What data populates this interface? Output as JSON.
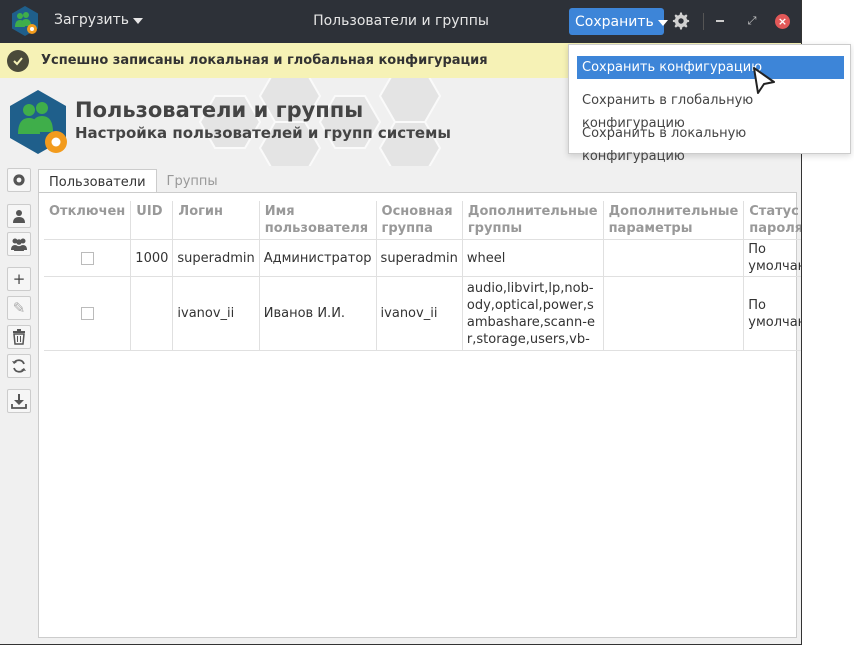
{
  "titlebar": {
    "load_label": "Загрузить",
    "window_title": "Пользователи и группы",
    "save_label": "Сохранить"
  },
  "notification": {
    "text": "Успешно записаны локальная и глобальная конфигурация"
  },
  "banner": {
    "title": "Пользователи и группы",
    "subtitle": "Настройка пользователей и групп системы"
  },
  "tabs": [
    {
      "label": "Пользователи",
      "active": true
    },
    {
      "label": "Группы",
      "active": false
    }
  ],
  "table": {
    "columns": [
      "Отключен",
      "UID",
      "Логин",
      "Имя пользователя",
      "Основная группа",
      "Дополнительные группы",
      "Дополнительные параметры",
      "Статус пароля"
    ],
    "rows": [
      {
        "uid": "1000",
        "login": "superadmin",
        "name": "Администратор",
        "group": "superadmin",
        "extra_groups": "wheel",
        "extra_params": "",
        "password_status": "По умолчанию"
      },
      {
        "uid": "",
        "login": "ivanov_ii",
        "name": "Иванов И.И.",
        "group": "ivanov_ii",
        "extra_groups": "audio,libvirt,lp,nob-ody,optical,power,sambashare,scann-er,storage,users,vb-",
        "extra_params": "",
        "password_status": "По умолчанию"
      }
    ]
  },
  "dropdown": {
    "items": [
      "Сохранить конфигурацию",
      "Сохранить в глобальную конфигурацию",
      "Сохранить в локальную конфигурацию"
    ]
  },
  "colors": {
    "titlebar": "#2d3138",
    "accent": "#3d85d8",
    "notification": "#f6f2b6",
    "close": "#e25858",
    "icon_green": "#3fae4a",
    "icon_blue": "#1f5f8b",
    "icon_orange": "#f29b1d"
  }
}
